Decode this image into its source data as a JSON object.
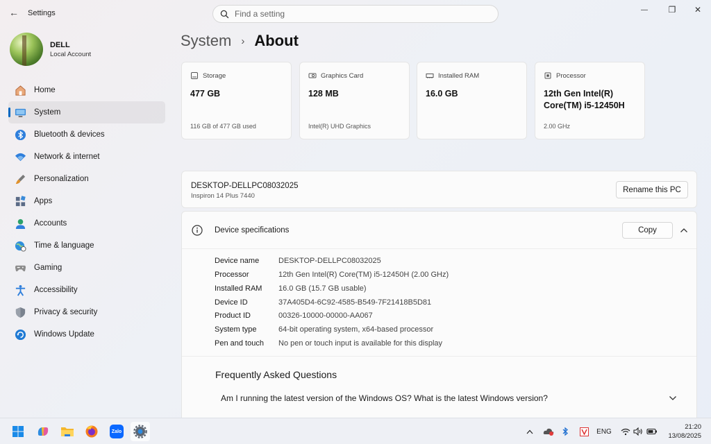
{
  "window": {
    "app_title": "Settings",
    "back_glyph": "←",
    "minimize_glyph": "—",
    "maximize_glyph": "❐",
    "close_glyph": "✕"
  },
  "search": {
    "placeholder": "Find a setting"
  },
  "profile": {
    "name": "DELL",
    "account_type": "Local Account"
  },
  "sidebar": {
    "items": [
      {
        "label": "Home",
        "icon": "home-icon"
      },
      {
        "label": "System",
        "icon": "monitor-icon",
        "active": true
      },
      {
        "label": "Bluetooth & devices",
        "icon": "bluetooth-icon"
      },
      {
        "label": "Network & internet",
        "icon": "wifi-icon"
      },
      {
        "label": "Personalization",
        "icon": "brush-icon"
      },
      {
        "label": "Apps",
        "icon": "apps-icon"
      },
      {
        "label": "Accounts",
        "icon": "person-icon"
      },
      {
        "label": "Time & language",
        "icon": "globe-clock-icon"
      },
      {
        "label": "Gaming",
        "icon": "gamepad-icon"
      },
      {
        "label": "Accessibility",
        "icon": "accessibility-icon"
      },
      {
        "label": "Privacy & security",
        "icon": "shield-icon"
      },
      {
        "label": "Windows Update",
        "icon": "update-icon"
      }
    ]
  },
  "breadcrumb": {
    "parent": "System",
    "separator": "›",
    "current": "About"
  },
  "cards": [
    {
      "label": "Storage",
      "value": "477 GB",
      "sub": "116 GB of 477 GB used"
    },
    {
      "label": "Graphics Card",
      "value": "128 MB",
      "sub": "Intel(R) UHD Graphics"
    },
    {
      "label": "Installed RAM",
      "value": "16.0 GB",
      "sub": ""
    },
    {
      "label": "Processor",
      "value": "12th Gen Intel(R) Core(TM) i5-12450H",
      "sub": "2.00 GHz"
    }
  ],
  "pc": {
    "name": "DESKTOP-DELLPC08032025",
    "model": "Inspiron 14 Plus 7440",
    "rename_label": "Rename this PC"
  },
  "specs": {
    "title": "Device specifications",
    "copy_label": "Copy",
    "rows": [
      {
        "key": "Device name",
        "value": "DESKTOP-DELLPC08032025"
      },
      {
        "key": "Processor",
        "value": "12th Gen Intel(R) Core(TM) i5-12450H (2.00 GHz)"
      },
      {
        "key": "Installed RAM",
        "value": "16.0 GB (15.7 GB usable)"
      },
      {
        "key": "Device ID",
        "value": "37A405D4-6C92-4585-B549-7F21418B5D81"
      },
      {
        "key": "Product ID",
        "value": "00326-10000-00000-AA067"
      },
      {
        "key": "System type",
        "value": "64-bit operating system, x64-based processor"
      },
      {
        "key": "Pen and touch",
        "value": "No pen or touch input is available for this display"
      }
    ]
  },
  "faq": {
    "title": "Frequently Asked Questions",
    "question": "Am I running the latest version of the Windows OS? What is the latest Windows version?"
  },
  "taskbar": {
    "apps": [
      "windows-start",
      "copilot",
      "file-explorer",
      "firefox",
      "zalo",
      "settings"
    ],
    "zalo_label": "Zalo",
    "language": "ENG",
    "time": "21:20",
    "date": "13/08/2025"
  }
}
